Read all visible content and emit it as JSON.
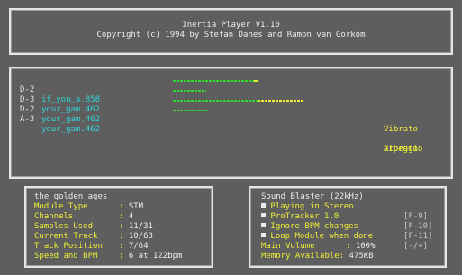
{
  "header": {
    "title": "Inertia Player V1.10",
    "copyright": "Copyright (c) 1994 by Stefan Danes and Ramon van Gorkom"
  },
  "tracks": [
    {
      "note": "D-2",
      "sample": "if_you_a.858",
      "level": 0.56,
      "peak": true,
      "effect": ""
    },
    {
      "note": "D-3",
      "sample": "your_gam.462",
      "level": 0.23,
      "peak": false,
      "effect": "Vibrato"
    },
    {
      "note": "D-2",
      "sample": "your_gam.462",
      "level": 0.59,
      "peak": false,
      "effect": "Arpeggio",
      "extra": 0.32
    },
    {
      "note": "A-3",
      "sample": "your_gam.462",
      "level": 0.25,
      "peak": false,
      "effect": "Vibrato"
    }
  ],
  "module": {
    "name": "the golden ages",
    "type_label": "Module Type",
    "type_value": "STM",
    "channels_label": "Channels",
    "channels_value": "4",
    "samples_label": "Samples Used",
    "samples_value": "11/31",
    "track_label": "Current Track",
    "track_value": "10/63",
    "position_label": "Track Position",
    "position_value": "7/64",
    "speed_label": "Speed and BPM",
    "speed_value": "6 at 122bpm",
    "separator": ":"
  },
  "device": {
    "name": "Sound Blaster (22kHz)",
    "options": [
      {
        "label": "Playing in Stereo",
        "key": ""
      },
      {
        "label": "ProTracker 1.0",
        "key": "[F-9]"
      },
      {
        "label": "Ignore BPM changes",
        "key": "[F-10]"
      },
      {
        "label": "Loop Module when done",
        "key": "[F-11]"
      }
    ],
    "volume_label": "Main Volume",
    "volume_value": "100%",
    "volume_key": "[-/+]",
    "memory_label": "Memory Available:",
    "memory_value": "475KB"
  },
  "colors": {
    "background": "#5e5e5e",
    "sample_text": "#2fd3d8",
    "label_text": "#eeee38",
    "value_text": "#ececec",
    "meter_green": "#34d834",
    "meter_yellow": "#eeee38"
  }
}
